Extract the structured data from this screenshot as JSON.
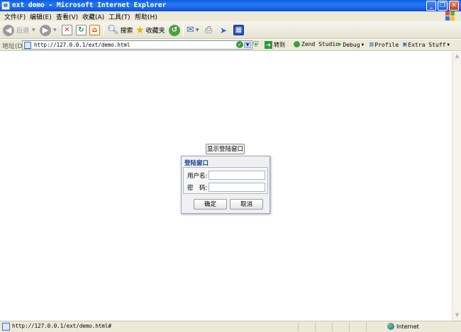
{
  "window": {
    "title": "ext demo - Microsoft Internet Explorer",
    "buttons": [
      "_",
      "❐",
      "✕"
    ]
  },
  "menubar": {
    "items": [
      "文件(F)",
      "编辑(E)",
      "查看(V)",
      "收藏(A)",
      "工具(T)",
      "帮助(H)"
    ]
  },
  "toolbar": {
    "back_label": "后退",
    "search_label": "搜索",
    "favorites_label": "收藏夹"
  },
  "addressbar": {
    "label": "地址(D)",
    "url": "http://127.0.0.1/ext/demo.html",
    "go_label": "转到",
    "links": [
      "Zend Studio",
      "Debug",
      "Profile",
      "Extra Stuff"
    ]
  },
  "page": {
    "show_button": "显示登陆窗口",
    "dialog": {
      "title": "登陆窗口",
      "username_label": "用户名:",
      "password_label": "密　码:",
      "ok_label": "确定",
      "cancel_label": "取消"
    }
  },
  "statusbar": {
    "text": "http://127.0.0.1/ext/demo.html#",
    "zone": "Internet"
  },
  "colors": {
    "titlebar": "#0b54e0",
    "chrome": "#ece9d8",
    "dialog_title": "#15428b"
  }
}
